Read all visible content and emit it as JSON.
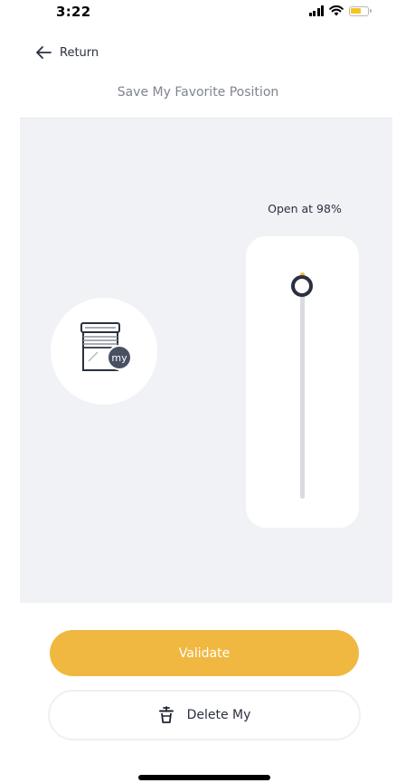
{
  "status_bar": {
    "time": "3:22",
    "icons": [
      "signal-icon",
      "wifi-icon",
      "battery-icon"
    ],
    "battery_color": "#f7c51e"
  },
  "header": {
    "return_label": "Return",
    "return_icon": "arrow-left-icon",
    "title": "Save My Favorite Position"
  },
  "device": {
    "icon": "blind-my-icon",
    "badge_text": "my",
    "badge_color": "#4a5063"
  },
  "slider": {
    "label": "Open at 98%",
    "value_percent": 98,
    "accent_color": "#f0b840",
    "thumb_color": "#2b3040"
  },
  "actions": {
    "validate_label": "Validate",
    "validate_color": "#f0b840",
    "delete_label": "Delete My",
    "delete_icon": "trash-icon"
  }
}
